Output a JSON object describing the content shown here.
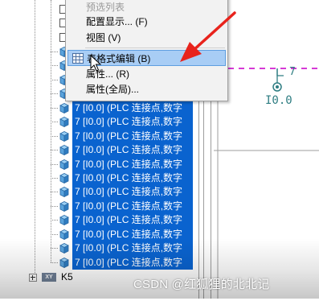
{
  "context_menu": {
    "items": [
      {
        "label": "预选列表",
        "disabled": true
      },
      {
        "label": "配置显示... (F)"
      },
      {
        "label": "视图 (V)"
      },
      {
        "label": "表格式编辑 (B)",
        "highlighted": true,
        "icon": "table-grid-icon"
      },
      {
        "label": "属性... (R)"
      },
      {
        "label": "属性(全局)..."
      }
    ]
  },
  "tree": {
    "nodes": [
      {
        "text": "7  [I0.0] (PLC 连接点,数字"
      },
      {
        "text": "7  [I0.0] (PLC 连接点,数字"
      },
      {
        "text": "7  [I0.0] (PLC 连接点,数字"
      },
      {
        "text": "7  [I0.0] (PLC 连接点,数字"
      },
      {
        "text": "7  [I0.0] (PLC 连接点,数字"
      },
      {
        "text": "7  [I0.0] (PLC 连接点,数字"
      },
      {
        "text": "7  [I0.0] (PLC 连接点,数字"
      },
      {
        "text": "7  [I0.0] (PLC 连接点,数字"
      },
      {
        "text": "7  [I0.0] (PLC 连接点,数字"
      },
      {
        "text": "7  [I0.0] (PLC 连接点,数字"
      },
      {
        "text": "7  [I0.0] (PLC 连接点,数字"
      },
      {
        "text": "7  [I0.0] (PLC 连接点,数字"
      },
      {
        "text": "7  [I0.0] (PLC 连接点,数字"
      },
      {
        "text": "7  [I0.0] (PLC 连接点,数字"
      },
      {
        "text": "7  [I0.0] (PLC 连接点,数字"
      },
      {
        "text": "7  [I0.0] (PLC 连接点,数字"
      }
    ],
    "k5": {
      "icon_text": "XY",
      "label": "K5"
    }
  },
  "canvas": {
    "symbol_number": "7",
    "symbol_address": "I0.0"
  },
  "watermark": "CSDN @红狐狸的北北记",
  "colors": {
    "selection": "#0a63cf",
    "menu_highlight": "#a8cdf5",
    "annotation_arrow": "#e8231c",
    "dashed_line": "#d63ad6",
    "symbol": "#2e7d82"
  }
}
